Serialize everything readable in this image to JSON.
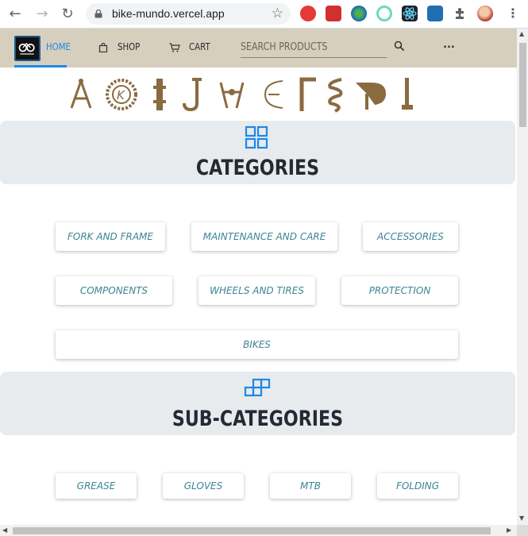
{
  "browser": {
    "url": "bike-mundo.vercel.app",
    "back_icon": "arrow-left-icon",
    "forward_icon": "arrow-right-icon",
    "reload_icon": "reload-icon",
    "extensions": [
      "opera-icon",
      "pdf-icon",
      "globe-extension-icon",
      "target-extension-icon",
      "react-devtools-icon",
      "s-extension-icon",
      "puzzle-icon",
      "profile-avatar"
    ]
  },
  "header": {
    "home_label": "HOME",
    "shop_label": "SHOP",
    "cart_label": "CART",
    "search_placeholder": "SEARCH PRODUCTS",
    "more_label": "...",
    "accent": "#1e88e5",
    "bar_color": "#d6cfbe"
  },
  "parts_strip": [
    "brake-icon",
    "chainring-icon",
    "hub-icon",
    "seatpost-icon",
    "derailleur-icon",
    "rim-icon",
    "frame-tube-icon",
    "spring-icon",
    "saddle-icon",
    "pump-icon"
  ],
  "categories": {
    "title": "CATEGORIES",
    "icon": "grid-icon",
    "items": [
      [
        "FORK AND FRAME",
        "MAINTENANCE AND CARE",
        "ACCESSORIES"
      ],
      [
        "COMPONENTS",
        "WHEELS AND TIRES",
        "PROTECTION"
      ],
      [
        "BIKES"
      ]
    ]
  },
  "subcategories": {
    "title": "SUB-CATEGORIES",
    "icon": "blocks-icon",
    "items": [
      "GREASE",
      "GLOVES",
      "MTB",
      "FOLDING"
    ]
  },
  "colors": {
    "chip_text": "#3b8593",
    "banner_bg": "#e7ebee",
    "part_brown": "#8a6a3f"
  }
}
